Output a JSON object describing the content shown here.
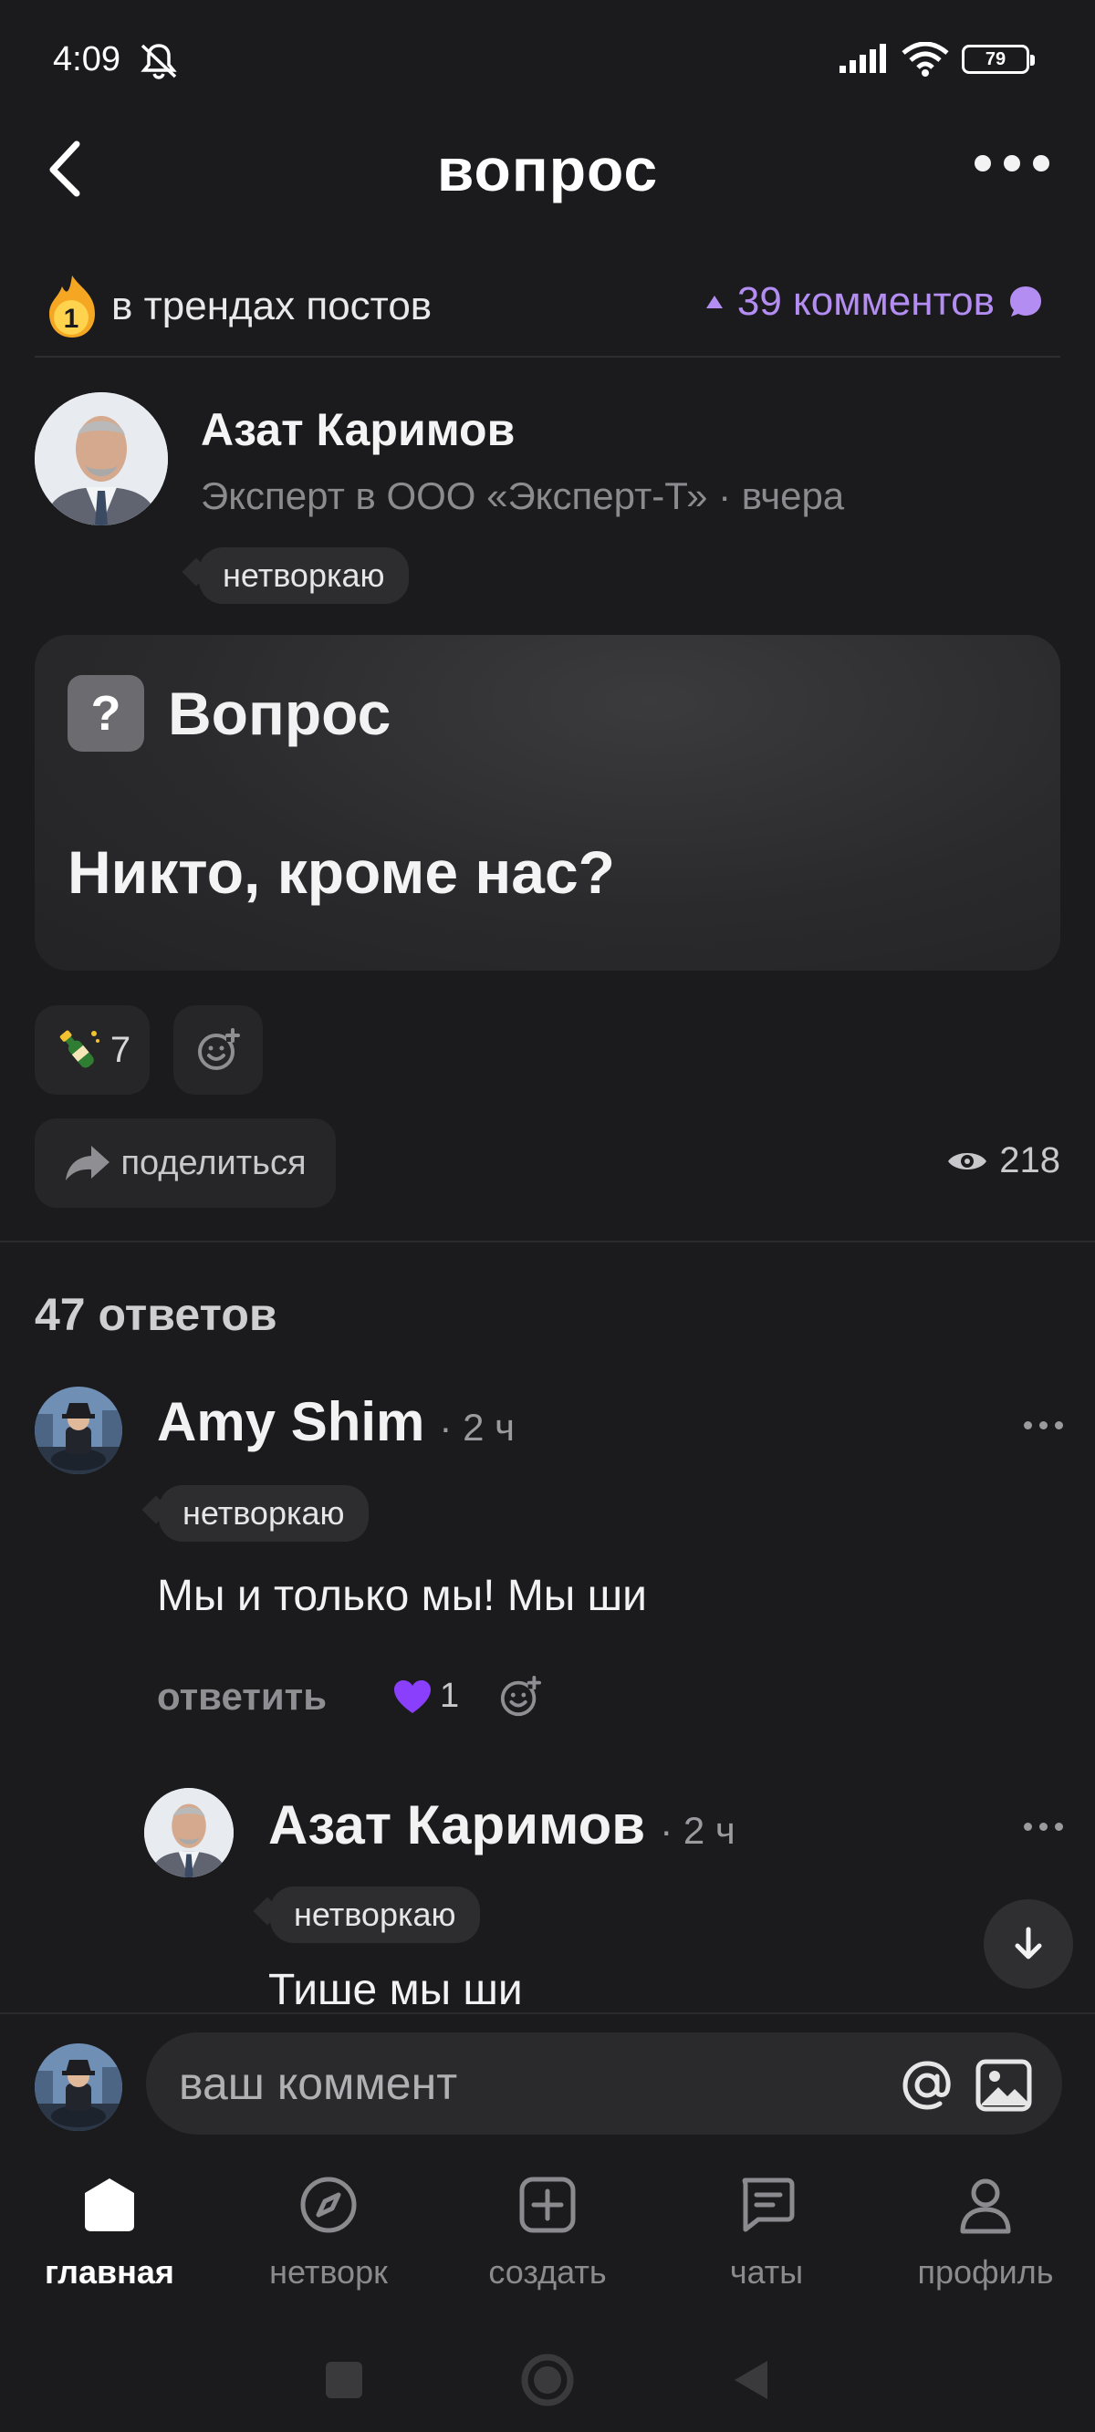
{
  "status_bar": {
    "time": "4:09",
    "battery": "79"
  },
  "header": {
    "title": "вопрос"
  },
  "trend": {
    "label": "в трендах постов",
    "rank": "1"
  },
  "comments_link": {
    "label": "39 комментов"
  },
  "post": {
    "author": "Азат Каримов",
    "meta": "Эксперт в ООО «Эксперт-Т» · вчера",
    "tag": "нетворкаю",
    "type_label": "Вопрос",
    "question": "Никто, кроме нас?",
    "reaction_count": "7",
    "share_label": "поделиться",
    "views": "218"
  },
  "answers": {
    "count_label": "47 ответов"
  },
  "comments": [
    {
      "author": "Amy Shim",
      "time": "· 2 ч",
      "tag": "нетворкаю",
      "text": "Мы и только мы! Мы ши",
      "reply_label": "ответить",
      "likes": "1"
    },
    {
      "author": "Азат Каримов",
      "time": "· 2 ч",
      "tag": "нетворкаю",
      "text": "Тише мы ши"
    }
  ],
  "composer": {
    "placeholder": "ваш коммент"
  },
  "nav": {
    "items": [
      {
        "label": "главная",
        "icon": "home-icon"
      },
      {
        "label": "нетворк",
        "icon": "compass-icon"
      },
      {
        "label": "создать",
        "icon": "plus-square-icon"
      },
      {
        "label": "чаты",
        "icon": "chat-icon"
      },
      {
        "label": "профиль",
        "icon": "profile-icon"
      }
    ]
  },
  "colors": {
    "accent": "#b38df2",
    "background": "#1b1b1d",
    "card": "#2a2a2c",
    "heart": "#8a3ffc"
  }
}
